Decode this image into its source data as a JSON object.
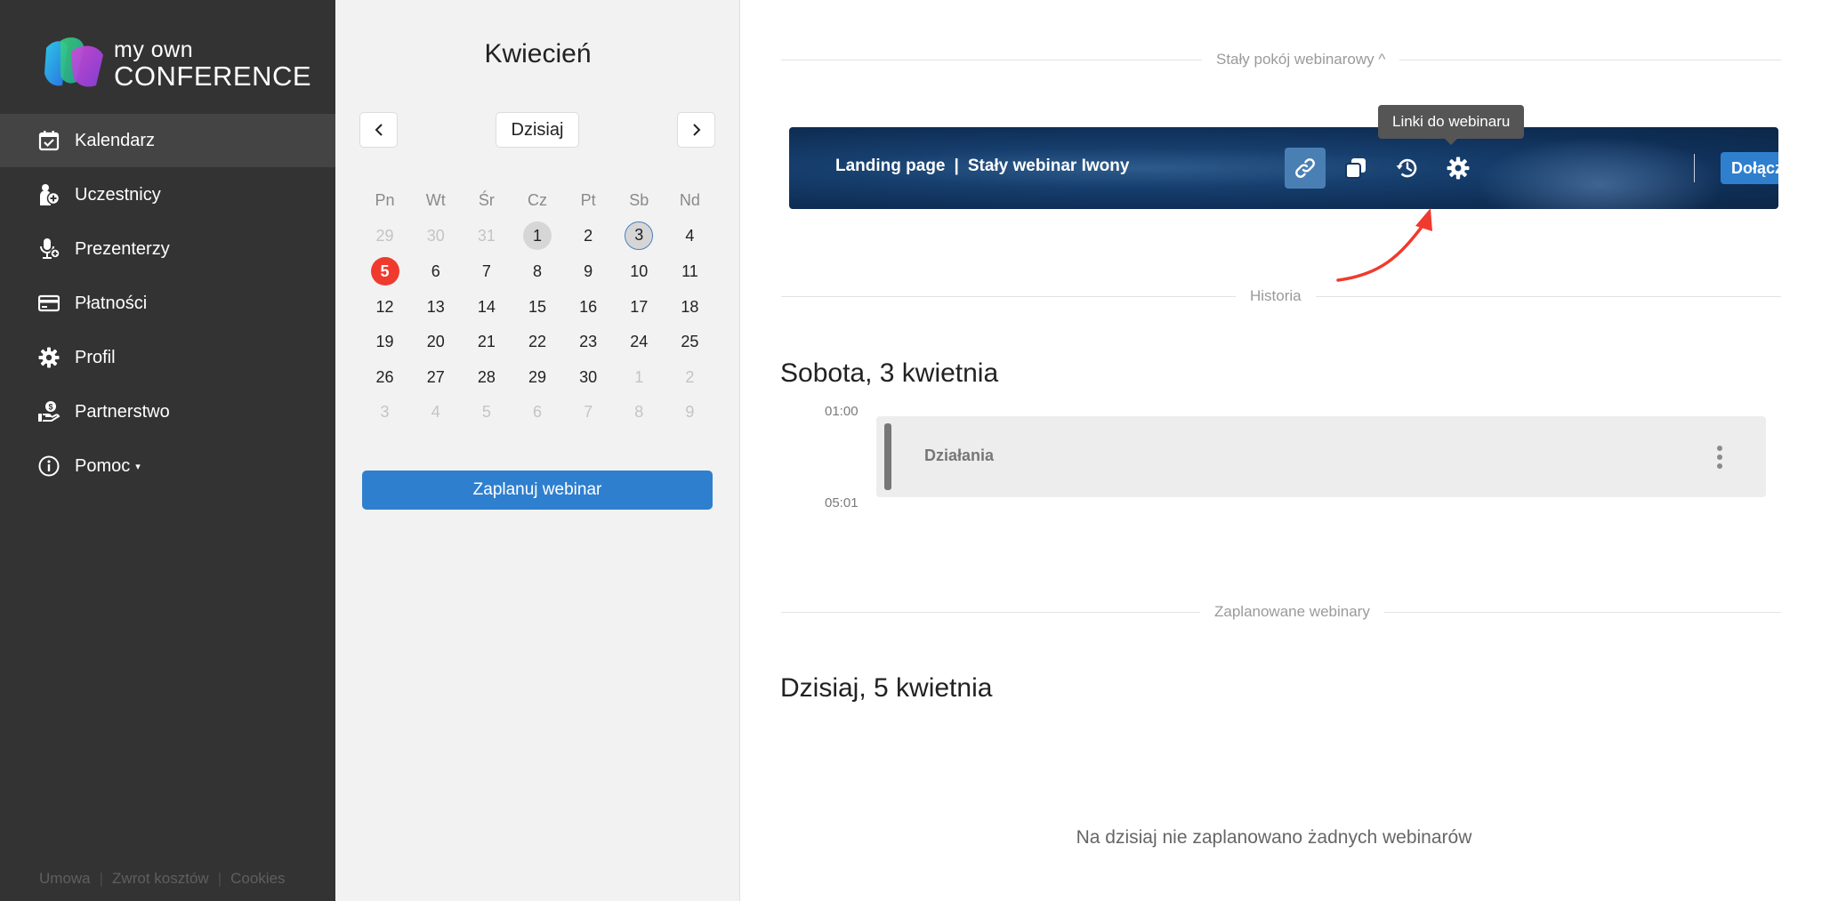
{
  "brand": {
    "line1": "my own",
    "line2": "CONFERENCE"
  },
  "sidebar": {
    "items": [
      {
        "label": "Kalendarz",
        "icon": "calendar-check-icon"
      },
      {
        "label": "Uczestnicy",
        "icon": "user-add-icon"
      },
      {
        "label": "Prezenterzy",
        "icon": "microphone-user-icon"
      },
      {
        "label": "Płatności",
        "icon": "credit-card-icon"
      },
      {
        "label": "Profil",
        "icon": "gear-icon"
      },
      {
        "label": "Partnerstwo",
        "icon": "hand-money-icon"
      },
      {
        "label": "Pomoc",
        "icon": "info-circle-icon"
      }
    ],
    "footer": [
      "Umowa",
      "Zwrot kosztów",
      "Cookies"
    ]
  },
  "calendar": {
    "month": "Kwiecień",
    "today_button": "Dzisiaj",
    "weekdays": [
      "Pn",
      "Wt",
      "Śr",
      "Cz",
      "Pt",
      "Sb",
      "Nd"
    ],
    "weeks": [
      [
        "29",
        "30",
        "31",
        "1",
        "2",
        "3",
        "4"
      ],
      [
        "5",
        "6",
        "7",
        "8",
        "9",
        "10",
        "11"
      ],
      [
        "12",
        "13",
        "14",
        "15",
        "16",
        "17",
        "18"
      ],
      [
        "19",
        "20",
        "21",
        "22",
        "23",
        "24",
        "25"
      ],
      [
        "26",
        "27",
        "28",
        "29",
        "30",
        "1",
        "2"
      ],
      [
        "3",
        "4",
        "5",
        "6",
        "7",
        "8",
        "9"
      ]
    ],
    "plan_button": "Zaplanuj webinar"
  },
  "main": {
    "permanent_room_label": "Stały pokój webinarowy ^",
    "banner": {
      "landing": "Landing page",
      "separator": "|",
      "name": "Stały webinar Iwony",
      "join_button": "Dołącz",
      "tooltip": "Linki do webinaru"
    },
    "history_label": "Historia",
    "history_day": "Sobota, 3 kwietnia",
    "event": {
      "start": "01:00",
      "end": "05:01",
      "title": "Działania"
    },
    "scheduled_label": "Zaplanowane webinary",
    "today_heading": "Dzisiaj, 5 kwietnia",
    "empty_message": "Na dzisiaj nie zaplanowano żadnych webinarów"
  },
  "colors": {
    "sidebar_bg": "#333333",
    "accent": "#2f7fcf",
    "today_marker": "#f03a2e",
    "annotation_arrow": "#f03a2e"
  }
}
